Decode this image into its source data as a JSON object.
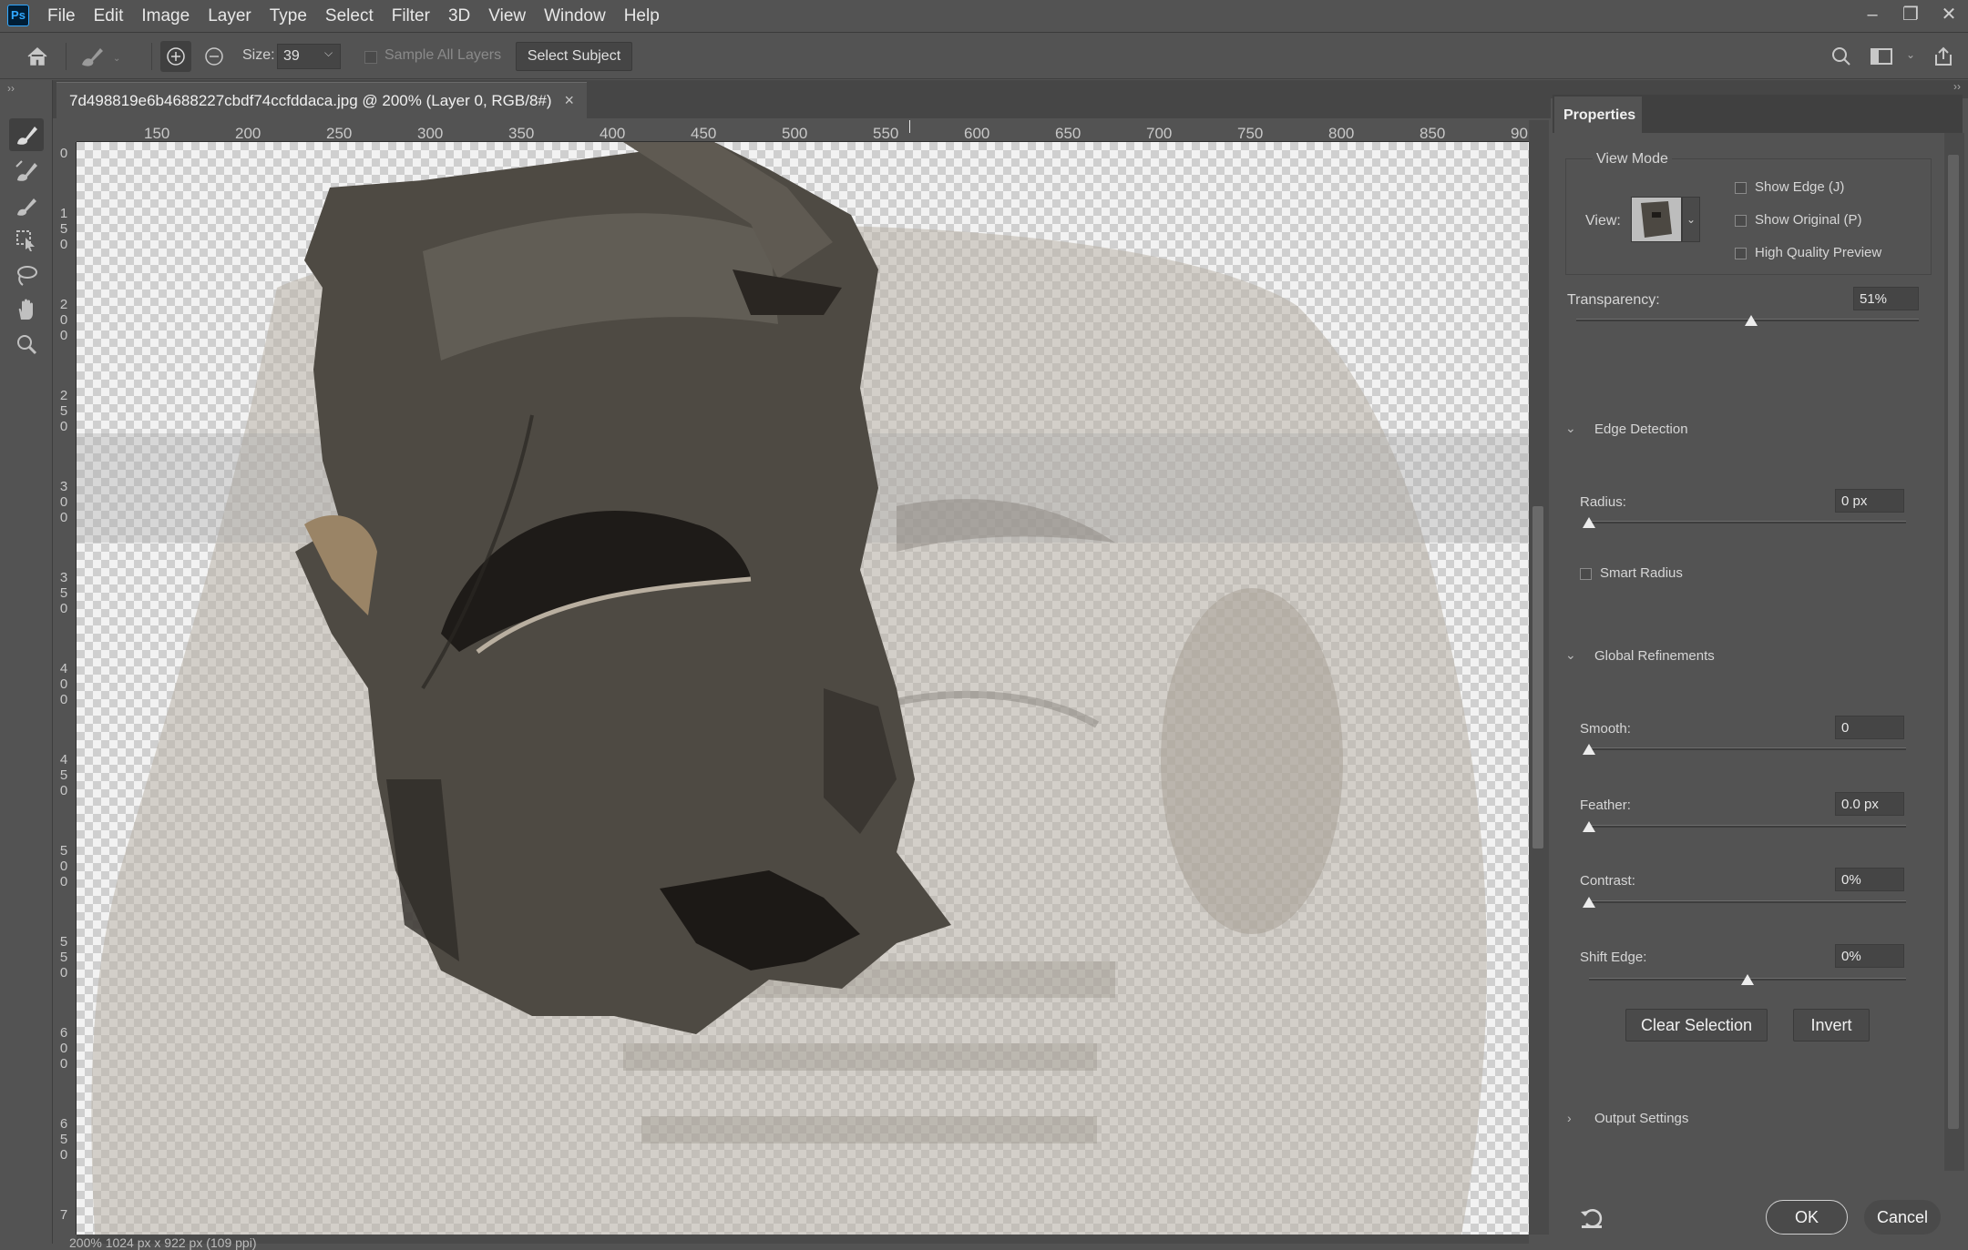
{
  "app": {
    "logo_text": "Ps"
  },
  "menu": [
    "File",
    "Edit",
    "Image",
    "Layer",
    "Type",
    "Select",
    "Filter",
    "3D",
    "View",
    "Window",
    "Help"
  ],
  "window_controls": {
    "minimize": "–",
    "restore": "❐",
    "close": "✕"
  },
  "options_bar": {
    "size_label": "Size:",
    "size_value": "39",
    "sample_all_layers_label": "Sample All Layers",
    "select_subject_label": "Select Subject"
  },
  "document": {
    "tab_title": "7d498819e6b4688227cbdf74ccfddaca.jpg @ 200% (Layer 0, RGB/8#)",
    "close_glyph": "×",
    "status_text": "200%        1024 px x 922 px (109 ppi)"
  },
  "ruler": {
    "h_labels": [
      "150",
      "200",
      "250",
      "300",
      "350",
      "400",
      "450",
      "500",
      "550",
      "600",
      "650",
      "700",
      "750",
      "800",
      "850",
      "90"
    ],
    "v_labels": [
      "0",
      "150",
      "200",
      "250",
      "300",
      "350",
      "400",
      "450",
      "500",
      "550",
      "600",
      "650",
      "7"
    ]
  },
  "properties": {
    "tab": "Properties",
    "view_mode": {
      "title": "View Mode",
      "view_label": "View:",
      "show_edge": "Show Edge (J)",
      "show_original": "Show Original (P)",
      "high_quality": "High Quality Preview"
    },
    "transparency": {
      "label": "Transparency:",
      "value": "51%",
      "fraction": 0.51
    },
    "edge_detection": {
      "title": "Edge Detection",
      "radius_label": "Radius:",
      "radius_value": "0 px",
      "radius_fraction": 0,
      "smart_radius": "Smart Radius"
    },
    "global_refinements": {
      "title": "Global Refinements",
      "smooth_label": "Smooth:",
      "smooth_value": "0",
      "smooth_fraction": 0,
      "feather_label": "Feather:",
      "feather_value": "0.0 px",
      "feather_fraction": 0,
      "contrast_label": "Contrast:",
      "contrast_value": "0%",
      "contrast_fraction": 0,
      "shift_edge_label": "Shift Edge:",
      "shift_edge_value": "0%",
      "shift_edge_fraction": 0.5
    },
    "clear_selection": "Clear Selection",
    "invert": "Invert",
    "output_settings": "Output Settings",
    "ok": "OK",
    "cancel": "Cancel"
  },
  "colors": {
    "app_bg": "#535353",
    "panel_dark": "#464646",
    "accent": "#31a8ff"
  }
}
